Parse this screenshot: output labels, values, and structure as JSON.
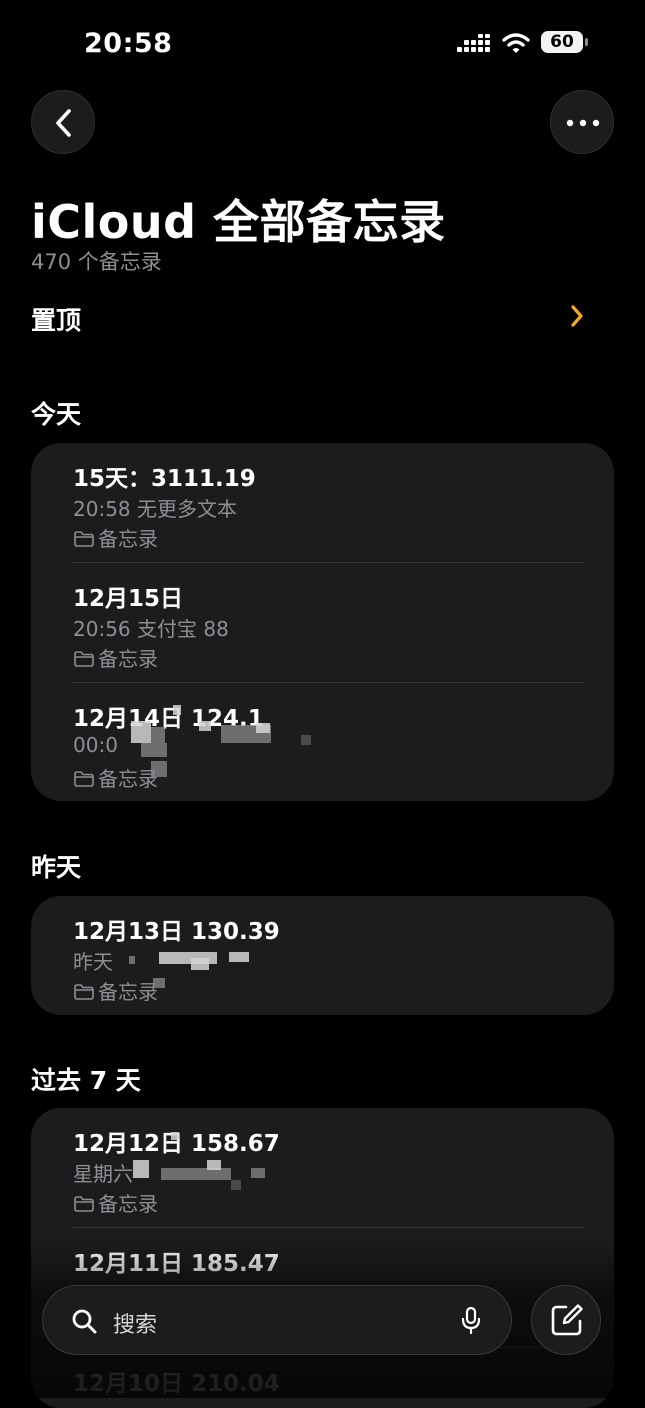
{
  "status_bar": {
    "time": "20:58",
    "battery": "60"
  },
  "header": {
    "title": "iCloud 全部备忘录",
    "note_count": "470 个备忘录",
    "pinned_label": "置顶"
  },
  "sections": [
    {
      "header": "今天",
      "notes": [
        {
          "title": "15天：3111.19",
          "meta": "20:58  无更多文本",
          "folder": "备忘录"
        },
        {
          "title": "12月15日",
          "meta": "20:56  支付宝 88",
          "folder": "备忘录"
        },
        {
          "title": "12月14日 124.1",
          "meta": "00:0",
          "folder": "备忘录"
        }
      ]
    },
    {
      "header": "昨天",
      "notes": [
        {
          "title": "12月13日  130.39",
          "meta": "昨天",
          "folder": "备忘录"
        }
      ]
    },
    {
      "header": "过去 7 天",
      "notes": [
        {
          "title": "12月12日 158.67",
          "meta": "星期六",
          "folder": "备忘录"
        },
        {
          "title": "12月11日 185.47",
          "meta": "",
          "folder": ""
        },
        {
          "title": "12月10日 210.04",
          "meta": "",
          "folder": ""
        }
      ]
    }
  ],
  "bottom_bar": {
    "search_placeholder": "搜索"
  },
  "colors": {
    "background": "#000000",
    "card": "#1c1c1e",
    "secondary_text": "#8e8e93",
    "accent": "#f5a623"
  },
  "icons": [
    "back-chevron-icon",
    "more-icon",
    "chevron-right-icon",
    "folder-icon",
    "search-icon",
    "mic-icon",
    "compose-icon",
    "signal-icon",
    "wifi-icon",
    "battery-icon"
  ]
}
